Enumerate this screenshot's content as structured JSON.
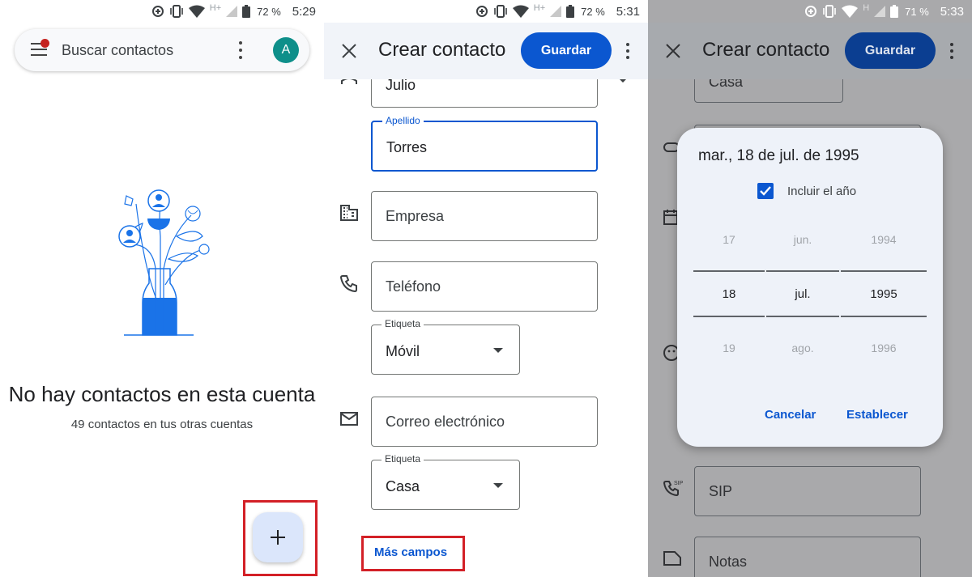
{
  "status_bars": [
    {
      "network": "H+",
      "battery": "72 %",
      "time": "5:29"
    },
    {
      "network": "H+",
      "battery": "72 %",
      "time": "5:31"
    },
    {
      "network": "H",
      "battery": "71 %",
      "time": "5:33"
    }
  ],
  "contacts_screen": {
    "search_placeholder": "Buscar contactos",
    "avatar_letter": "A",
    "empty_title": "No hay contactos en esta cuenta",
    "empty_subtitle": "49 contactos en tus otras cuentas",
    "fab_symbol": "+"
  },
  "create_contact": {
    "title": "Crear contacto",
    "save_label": "Guardar",
    "fields": {
      "first_name_value": "Julio",
      "last_name_label": "Apellido",
      "last_name_value": "Torres",
      "company_placeholder": "Empresa",
      "phone_placeholder": "Teléfono",
      "phone_label_caption": "Etiqueta",
      "phone_label_value": "Móvil",
      "email_placeholder": "Correo electrónico",
      "email_label_caption": "Etiqueta",
      "email_label_value": "Casa"
    },
    "more_fields_label": "Más campos"
  },
  "date_dialog_screen": {
    "title": "Crear contacto",
    "save_label": "Guardar",
    "top_field_value": "Casa",
    "sip_placeholder": "SIP",
    "notes_placeholder": "Notas",
    "dialog": {
      "date_heading": "mar., 18 de jul. de 1995",
      "include_year_label": "Incluir el año",
      "include_year_checked": true,
      "day": {
        "prev": "17",
        "selected": "18",
        "next": "19"
      },
      "month": {
        "prev": "jun.",
        "selected": "jul.",
        "next": "ago."
      },
      "year": {
        "prev": "1994",
        "selected": "1995",
        "next": "1996"
      },
      "cancel_label": "Cancelar",
      "set_label": "Establecer"
    }
  },
  "colors": {
    "primary": "#0b57d0",
    "highlight_box": "#d32027",
    "scrim": "#a9a9ab"
  }
}
